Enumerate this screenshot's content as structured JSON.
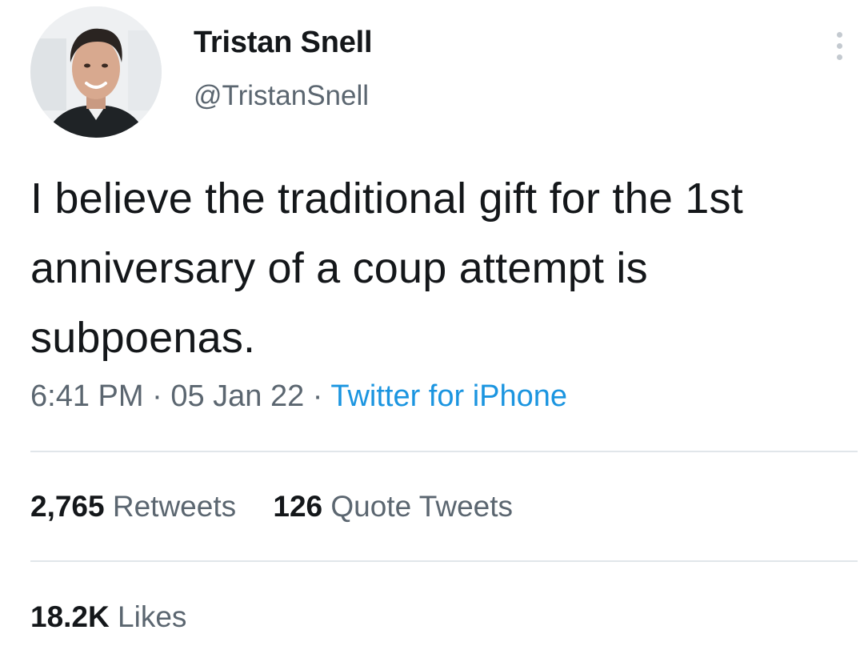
{
  "author": {
    "display_name": "Tristan Snell",
    "handle": "@TristanSnell"
  },
  "tweet": {
    "text": "I believe the traditional gift for the 1st anniversary of a coup attempt is subpoenas.",
    "time": "6:41 PM",
    "date": "05 Jan 22",
    "separator": "·",
    "source": "Twitter for iPhone"
  },
  "stats": {
    "retweets_count": "2,765",
    "retweets_label": "Retweets",
    "quotes_count": "126",
    "quotes_label": "Quote Tweets",
    "likes_count": "18.2K",
    "likes_label": "Likes"
  },
  "colors": {
    "link": "#1b95e0",
    "secondary_text": "#5b6670",
    "primary_text": "#14171a",
    "divider": "#e1e6ea"
  },
  "icons": {
    "more": "more-vertical-icon"
  }
}
